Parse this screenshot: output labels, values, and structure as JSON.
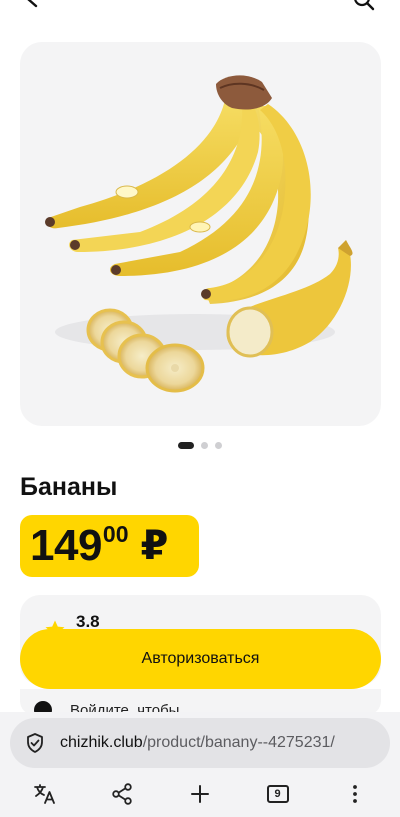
{
  "header": {
    "back_icon": "arrow-left-icon",
    "search_icon": "search-icon"
  },
  "product": {
    "image_icon": "bananas-photo",
    "gallery": {
      "count": 3,
      "active": 0
    },
    "title": "Бананы",
    "price_int": "149",
    "price_dec": "00",
    "currency": "₽"
  },
  "rating": {
    "value": "3.8",
    "star_color": "#ffd600"
  },
  "auth_button_label": "Авторизоваться",
  "partial_row_text": "Войдите, чтобы",
  "browser": {
    "url_host": "chizhik.club",
    "url_path": "/product/banany--4275231/",
    "tab_count": "9",
    "toolbar_icons": [
      "translate-icon",
      "share-icon",
      "add-icon",
      "tabs-icon",
      "more-icon"
    ]
  },
  "colors": {
    "accent": "#ffd600",
    "card_bg": "#f4f4f5",
    "text": "#111111"
  }
}
